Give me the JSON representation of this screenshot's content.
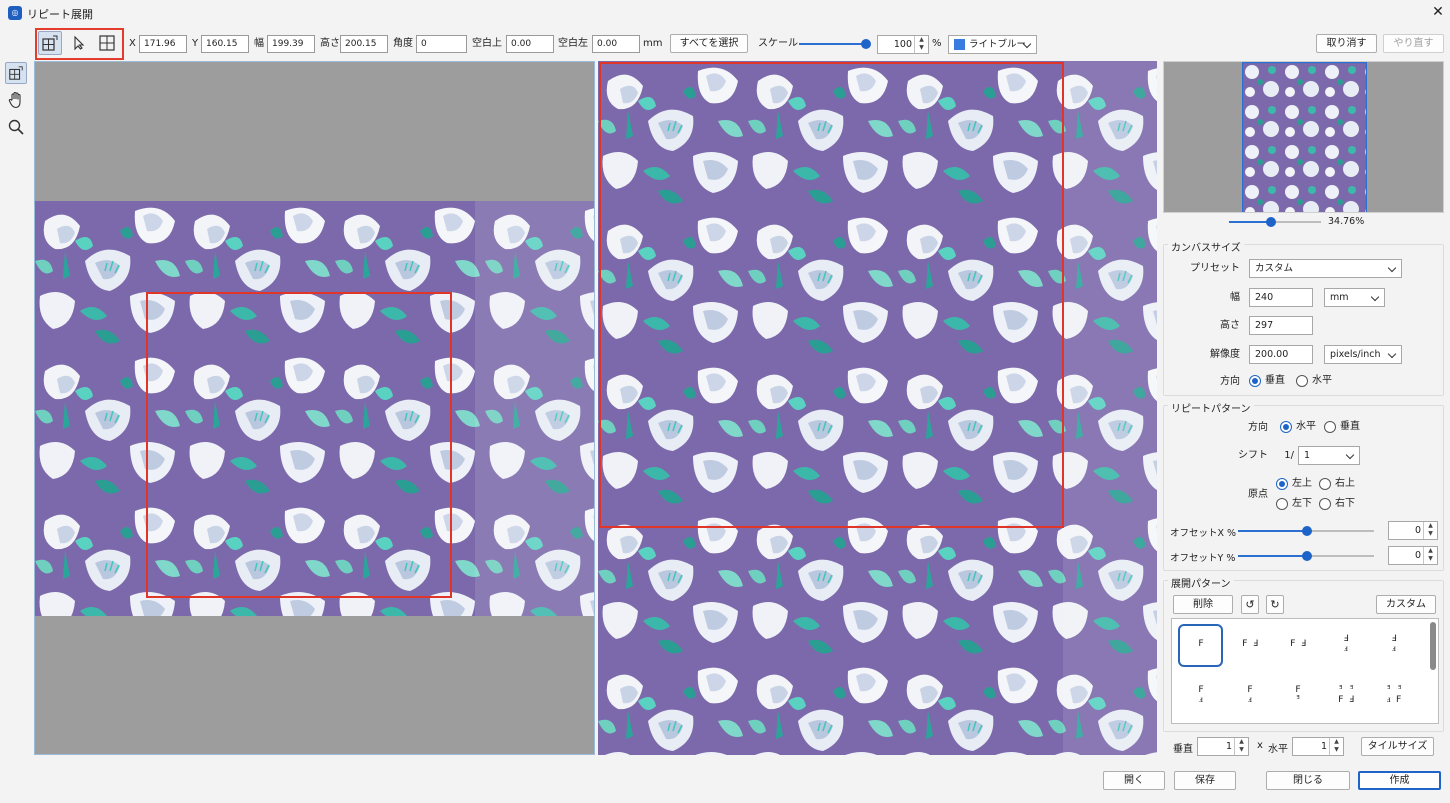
{
  "window": {
    "title": "リピート展開",
    "close": "✕"
  },
  "toolbar": {
    "x_label": "X",
    "x_value": "171.96",
    "y_label": "Y",
    "y_value": "160.15",
    "width_label": "幅",
    "width_value": "199.39",
    "height_label": "高さ",
    "height_value": "200.15",
    "angle_label": "角度",
    "angle_value": "0",
    "margin_top_label": "空白上",
    "margin_top_value": "0.00",
    "margin_left_label": "空白左",
    "margin_left_value": "0.00",
    "unit": "mm",
    "select_all": "すべてを選択",
    "scale_label": "スケール",
    "scale_value": "100",
    "scale_slider_level": 1.0,
    "percent": "%",
    "color_name": "ライトブルー",
    "color_swatch": "#3a7be0",
    "undo": "取り消す",
    "redo": "やり直す"
  },
  "preview": {
    "zoom": "34.76%",
    "zoom_slider_level": 0.45
  },
  "canvas_size": {
    "title": "カンバスサイズ",
    "preset_label": "プリセット",
    "preset_value": "カスタム",
    "width_label": "幅",
    "width_value": "240",
    "width_unit": "mm",
    "height_label": "高さ",
    "height_value": "297",
    "resolution_label": "解像度",
    "resolution_value": "200.00",
    "resolution_unit": "pixels/inch",
    "orientation_label": "方向",
    "orientation_vertical": "垂直",
    "orientation_horizontal": "水平"
  },
  "repeat_pattern": {
    "title": "リピートパターン",
    "direction_label": "方向",
    "direction_horizontal": "水平",
    "direction_vertical": "垂直",
    "shift_label": "シフト",
    "shift_prefix": "1/",
    "shift_value": "1",
    "origin_label": "原点",
    "origin_top_left": "左上",
    "origin_top_right": "右上",
    "origin_bottom_left": "左下",
    "origin_bottom_right": "右下",
    "offset_x_label": "オフセットX %",
    "offset_x_value": "0",
    "offset_x_level": 0.5,
    "offset_y_label": "オフセットY %",
    "offset_y_value": "0",
    "offset_y_level": 0.5
  },
  "expansion_pattern": {
    "title": "展開パターン",
    "delete": "削除",
    "rotate_ccw": "↺",
    "rotate_cw": "↻",
    "custom": "カスタム",
    "row1": [
      "F",
      "F Ⅎ",
      "F Ⅎ",
      "Ⅎ\nⅎ",
      "Ⅎ\nⅎ"
    ],
    "row2": [
      "F\nⅎ",
      "F\nⅎ",
      "F\nᴲ",
      "ᴲ ᴲ\nF Ⅎ",
      "ᴲ ᴲ\nⅎ F"
    ]
  },
  "tiling": {
    "vertical_label": "垂直",
    "vertical_value": "1",
    "times": "x",
    "horizontal_label": "水平",
    "horizontal_value": "1",
    "tile_size": "タイルサイズ"
  },
  "footer": {
    "open": "開く",
    "save": "保存",
    "close": "閉じる",
    "create": "作成"
  },
  "colors": {
    "accent": "#1e64c8",
    "selection_red": "#e0362a",
    "pattern_bg": "#7b68aa"
  }
}
